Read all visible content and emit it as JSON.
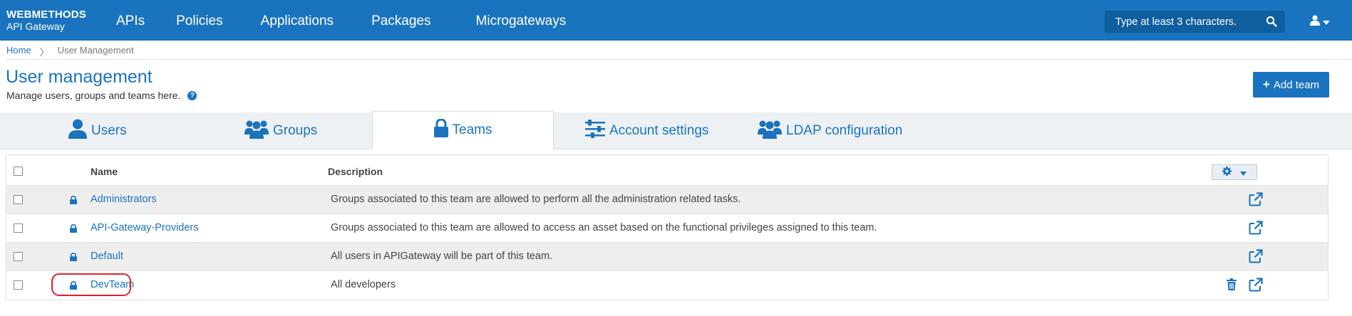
{
  "header": {
    "brand": "WEBMETHODS",
    "product": "API Gateway",
    "nav": [
      {
        "label": "APIs"
      },
      {
        "label": "Policies"
      },
      {
        "label": "Applications"
      },
      {
        "label": "Packages"
      },
      {
        "label": "Microgateways"
      }
    ],
    "search_placeholder": "Type at least 3 characters.",
    "colors": {
      "bar": "#1a73be",
      "search": "#0f5e9e"
    }
  },
  "breadcrumb": {
    "home": "Home",
    "separator": "〉",
    "current": "User Management"
  },
  "page": {
    "title": "User management",
    "subtitle": "Manage users, groups and teams here.",
    "add_button": "Add team"
  },
  "tabs": [
    {
      "label": "Users",
      "icon": "user-icon",
      "active": false
    },
    {
      "label": "Groups",
      "icon": "users-icon",
      "active": false
    },
    {
      "label": "Teams",
      "icon": "lock-icon",
      "active": true
    },
    {
      "label": "Account settings",
      "icon": "sliders-icon",
      "active": false
    },
    {
      "label": "LDAP configuration",
      "icon": "users-icon",
      "active": false
    }
  ],
  "table": {
    "columns": {
      "name": "Name",
      "description": "Description"
    },
    "rows": [
      {
        "name": "Administrators",
        "description": "Groups associated to this team are allowed to perform all the administration related tasks.",
        "deletable": false
      },
      {
        "name": "API-Gateway-Providers",
        "description": "Groups associated to this team are allowed to access an asset based on the functional privileges assigned to this team.",
        "deletable": false
      },
      {
        "name": "Default",
        "description": "All users in APIGateway will be part of this team.",
        "deletable": false
      },
      {
        "name": "DevTeam",
        "description": "All developers",
        "deletable": true
      }
    ]
  },
  "highlight_color": "#e0202a"
}
